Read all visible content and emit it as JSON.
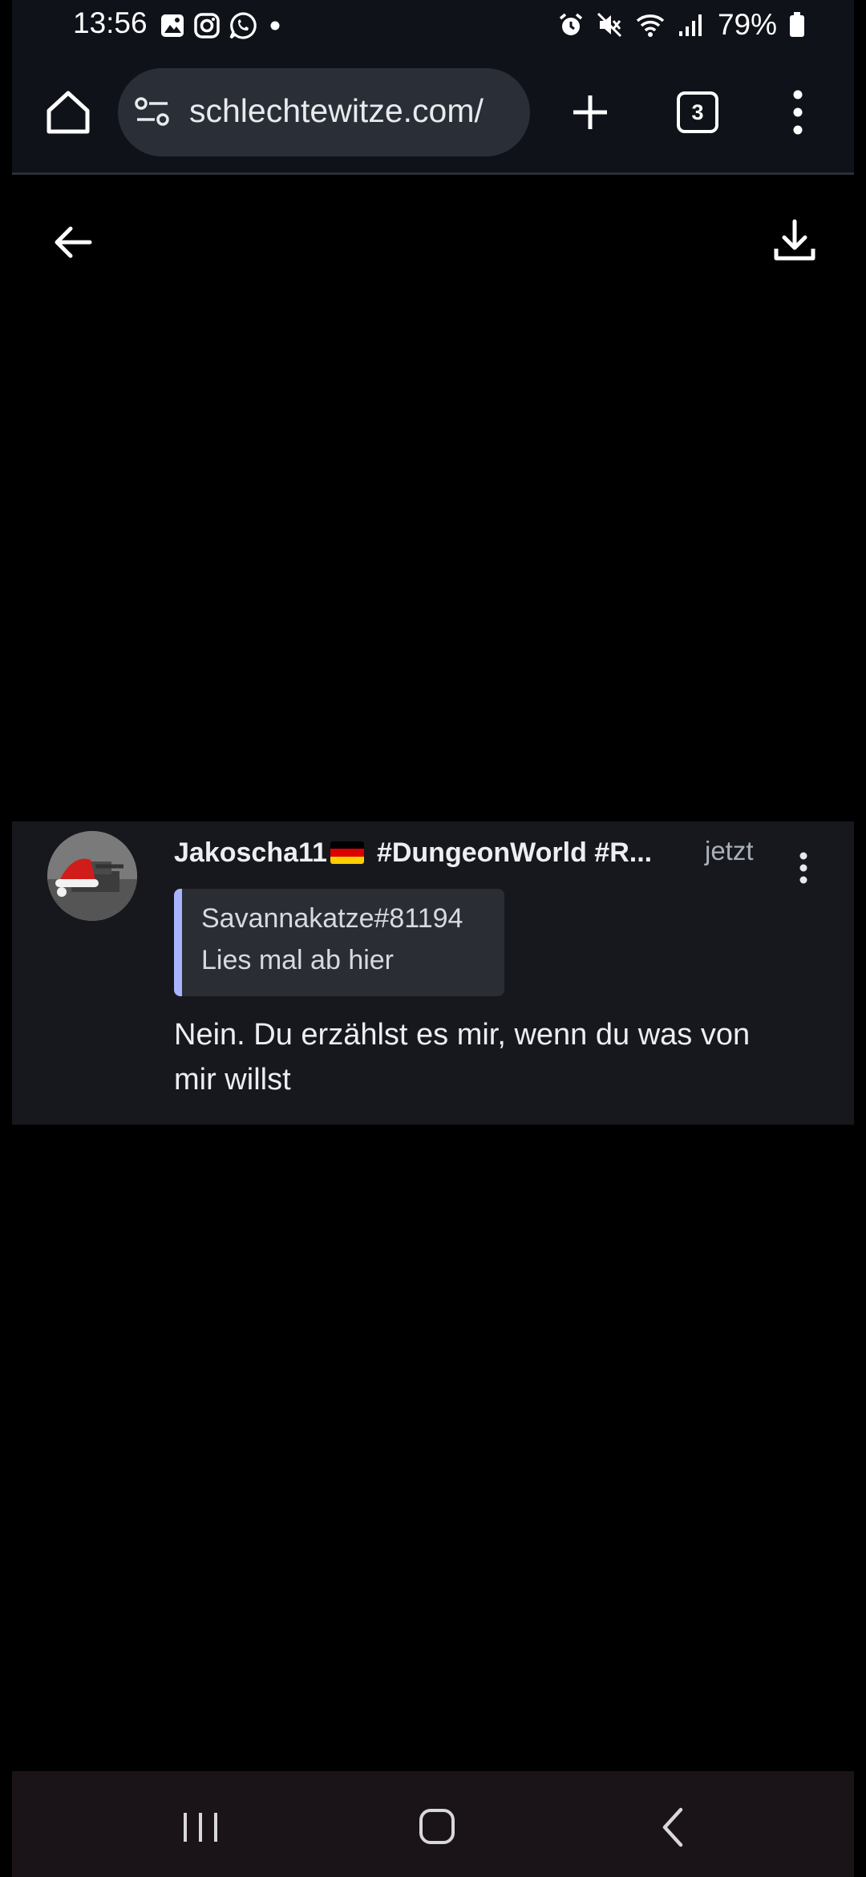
{
  "status_bar": {
    "time": "13:56",
    "battery": "79%",
    "notification_icons": [
      "gallery-icon",
      "instagram-icon",
      "whatsapp-icon",
      "dot-icon"
    ],
    "system_icons": [
      "alarm-icon",
      "mute-icon",
      "wifi-icon",
      "signal-icon",
      "battery-icon"
    ]
  },
  "browser": {
    "url": "schlechtewitze.com/",
    "tab_count": "3"
  },
  "message": {
    "author": "Jakoscha11",
    "tags": "#DungeonWorld #R...",
    "time": "jetzt",
    "quote": {
      "author": "Savannakatze#81194",
      "text": "Lies mal ab hier"
    },
    "body": "Nein. Du erzählst es mir, wenn du was von mir willst"
  },
  "colors": {
    "chrome_bg": "#0f1319",
    "card_bg": "#17181d",
    "quote_bar": "#a9b4ff",
    "nav_bg": "#1a1418"
  }
}
